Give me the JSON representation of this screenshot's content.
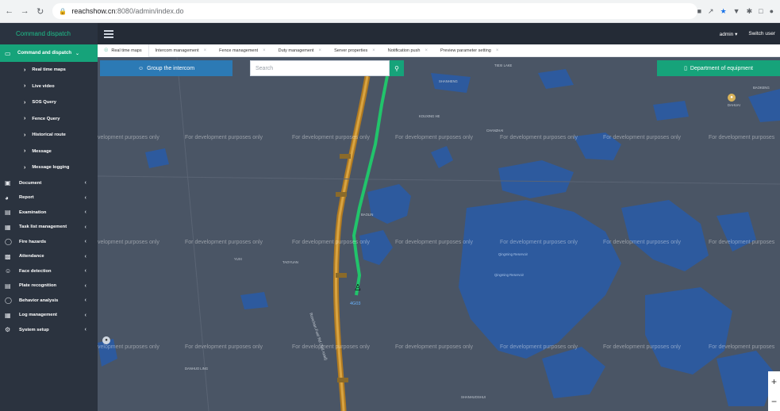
{
  "browser": {
    "url_host": "reachshow.cn",
    "url_path": ":8080/admin/index.do"
  },
  "header": {
    "brand": "Command dispatch",
    "user": "admin",
    "switch_user": "Switch user"
  },
  "sidebar": {
    "active": "Command and dispatch",
    "sub_items": [
      {
        "label": "Real time maps"
      },
      {
        "label": "Live video"
      },
      {
        "label": "SOS Query"
      },
      {
        "label": "Fence Query"
      },
      {
        "label": "Historical route"
      },
      {
        "label": "Message"
      },
      {
        "label": "Message logging"
      }
    ],
    "items": [
      {
        "label": "Document",
        "icon": "folder-icon"
      },
      {
        "label": "Report",
        "icon": "report-icon"
      },
      {
        "label": "Examination",
        "icon": "exam-icon"
      },
      {
        "label": "Task list management",
        "icon": "tasklist-icon"
      },
      {
        "label": "Fire hazards",
        "icon": "fire-icon"
      },
      {
        "label": "Attendance",
        "icon": "attendance-icon"
      },
      {
        "label": "Face detection",
        "icon": "face-icon"
      },
      {
        "label": "Plate recognition",
        "icon": "plate-icon"
      },
      {
        "label": "Behavior analysis",
        "icon": "behavior-icon"
      },
      {
        "label": "Log management",
        "icon": "log-icon"
      },
      {
        "label": "System setup",
        "icon": "settings-icon"
      }
    ]
  },
  "tabs": [
    {
      "label": "Real time maps"
    },
    {
      "label": "Intercom management"
    },
    {
      "label": "Fence management"
    },
    {
      "label": "Duty management"
    },
    {
      "label": "Server properties"
    },
    {
      "label": "Notification push"
    },
    {
      "label": "Preview parameter setting"
    }
  ],
  "map": {
    "group_button": "Group the intercom",
    "search_placeholder": "Search",
    "dept_button": "Department of equipment",
    "watermark": "For development purposes only",
    "watermark_clipped": "velopment purposes only",
    "watermark_right": "For development purposes",
    "person_label": "4G03",
    "labels": {
      "shanheng": "SHANHENG",
      "tiexi": "TIEXI LAKE",
      "baokeng": "BAOKENG",
      "dahuai": "DAHUAI",
      "kouling": "KOUXING HE",
      "chanzhai": "CHANZHAI",
      "qingming": "Qingming Reservoir",
      "qingming2": "Qingming Reservoir",
      "baolin": "BAOLIN",
      "yuxi": "YUXI",
      "taoyuan": "TAOYUAN",
      "road": "Ronchan Fuel Rd (Toll road)",
      "dinhuo": "DANHUO LING",
      "shanshou": "SHANHUOSHUI"
    }
  },
  "colors": {
    "accent": "#16a37a",
    "header": "#242b36",
    "sidebar": "#2b333f",
    "map_land": "#4a5565",
    "map_water": "#2d5a9e",
    "route": "#21c46b"
  }
}
